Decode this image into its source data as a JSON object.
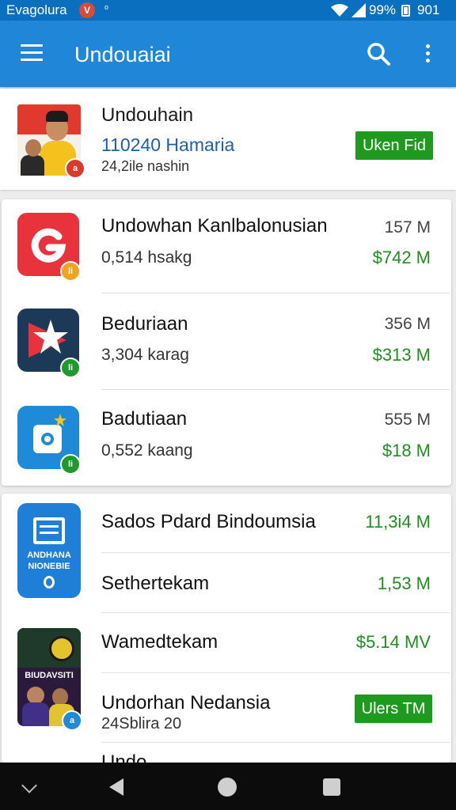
{
  "status_bar": {
    "carrier": "Evagolura",
    "badge": "V",
    "sync": "ᵒ",
    "battery_percent": "99%",
    "time": "901"
  },
  "app_bar": {
    "title": "Undouaiai",
    "search_icon": "search-icon",
    "menu_icon": "menu-icon",
    "more_icon": "more-vert-icon"
  },
  "featured": {
    "title": "Undouhain",
    "subtitle": "110240 Hamaria",
    "meta": "24,2ile nashin",
    "badge": "a",
    "button_label": "Uken Fid"
  },
  "list1": [
    {
      "title": "Undowhan Kanlbalonusian",
      "subtitle": "0,514 hsakg",
      "size": "157 M",
      "price": "$742 M",
      "badge": "li",
      "icon": "g-logo-icon",
      "icon_color": "#e8323c",
      "badge_color": "#f2a31c"
    },
    {
      "title": "Beduriaan",
      "subtitle": "3,304 karag",
      "size": "356 M",
      "price": "$313 M",
      "badge": "li",
      "icon": "star-play-icon",
      "icon_color": "#1c3a58",
      "badge_color": "#1e9a2a"
    },
    {
      "title": "Badutiaan",
      "subtitle": "0,552 kaang",
      "size": "555 M",
      "price": "$18 M",
      "badge": "li",
      "icon": "camera-icon",
      "icon_color": "#1f8ad8",
      "badge_color": "#1e9a2a"
    }
  ],
  "list2": {
    "app1": {
      "icon_text_1": "ANDHANA",
      "icon_text_2": "NIONEBIE",
      "icon": "document-icon",
      "icon_color": "#1f7fd6"
    },
    "app2": {
      "icon_text": "BIUDAVSITI",
      "icon": "poster-photo",
      "badge": "a",
      "badge_color": "#1f8ad8"
    },
    "rows": [
      {
        "title": "Sados Pdard Bindoumsia",
        "value": "11,3i4 M"
      },
      {
        "title": "Sethertekam",
        "value": "1,53 M"
      },
      {
        "title": "Wamedtekam",
        "value": "$5.14 MV"
      },
      {
        "title": "Undorhan Nedansia",
        "subtitle": "24Sblira 20",
        "button_label": "Ulers TM"
      }
    ],
    "partial_text": "Undo..."
  },
  "nav_bar": {
    "collapse_icon": "chevron-down-icon",
    "back_icon": "back-icon",
    "home_icon": "home-icon",
    "recents_icon": "recents-icon"
  }
}
